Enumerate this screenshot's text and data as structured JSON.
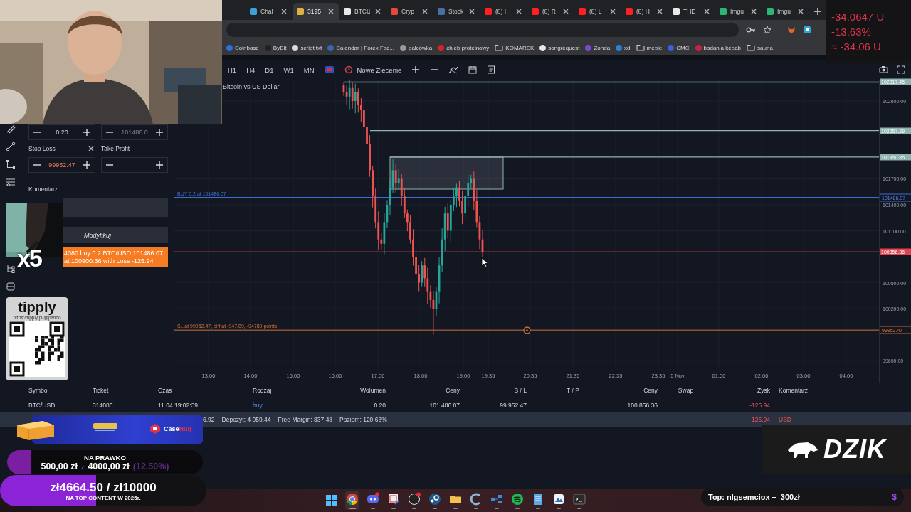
{
  "browser": {
    "tabs": [
      {
        "label": "Chal",
        "color": "#3aa0d8",
        "selected": false
      },
      {
        "label": "3195",
        "color": "#e0b040",
        "selected": true
      },
      {
        "label": "BTCU",
        "color": "#e8e8e8",
        "selected": false
      },
      {
        "label": "Cryp",
        "color": "#e24a3a",
        "selected": false
      },
      {
        "label": "Stock",
        "color": "#4a6fa8",
        "selected": false
      },
      {
        "label": "(8) I",
        "color": "#ff2020",
        "selected": false
      },
      {
        "label": "(8) R",
        "color": "#ff2020",
        "selected": false
      },
      {
        "label": "(8) L",
        "color": "#ff2020",
        "selected": false
      },
      {
        "label": "(8) H",
        "color": "#ff2020",
        "selected": false
      },
      {
        "label": "THE",
        "color": "#e8e8e8",
        "selected": false
      },
      {
        "label": "Imgu",
        "color": "#2bb673",
        "selected": false
      },
      {
        "label": "Imgu",
        "color": "#2bb673",
        "selected": false
      }
    ],
    "bookmarks": [
      {
        "label": "Coinbase",
        "kind": "site",
        "color": "#2f6fe0"
      },
      {
        "label": "ByBit",
        "kind": "site",
        "color": "#222222"
      },
      {
        "label": "script.txt",
        "kind": "site",
        "color": "#dddddd"
      },
      {
        "label": "Calendar | Forex Fac...",
        "kind": "site",
        "color": "#3a66b0"
      },
      {
        "label": "palcówka",
        "kind": "site",
        "color": "#9a9a9a"
      },
      {
        "label": "chleb proteinowy",
        "kind": "site",
        "color": "#e02020"
      },
      {
        "label": "KOMAREK",
        "kind": "folder"
      },
      {
        "label": "songrequest",
        "kind": "site",
        "color": "#e8e8e8"
      },
      {
        "label": "Zonda",
        "kind": "site",
        "color": "#7a4ad0"
      },
      {
        "label": "xd",
        "kind": "site",
        "color": "#2a7fe0"
      },
      {
        "label": "meble",
        "kind": "folder"
      },
      {
        "label": "CMC",
        "kind": "site",
        "color": "#3560e0"
      },
      {
        "label": "badania kebab",
        "kind": "site",
        "color": "#d02040"
      },
      {
        "label": "sauna",
        "kind": "folder"
      }
    ]
  },
  "chart_toolbar": {
    "timeframes": [
      "H1",
      "H4",
      "D1",
      "W1",
      "MN"
    ],
    "new_order": "Nowe Zlecenie"
  },
  "order_panel": {
    "volume": "0.20",
    "price": "101486.0",
    "stop_loss_label": "Stop Loss",
    "stop_loss": "99952.47",
    "take_profit_label": "Take Profit",
    "comment_label": "Komentarz",
    "modify_button": "Modyfikuj",
    "notification": [
      "4080 buy 0.2 BTC/USD 101486.07",
      "at 100900.36 with Loss -125.94"
    ]
  },
  "chart": {
    "title": "Bitcoin vs US Dollar",
    "price_lines": [
      {
        "kind": "level",
        "label": "102817.45"
      },
      {
        "kind": "level",
        "label": "102257.29"
      },
      {
        "kind": "level",
        "label": "101950.85"
      },
      {
        "kind": "buy",
        "label": "101486.07",
        "text": "BUY 0.2 at 101486.07"
      },
      {
        "kind": "current",
        "label": "100856.36"
      },
      {
        "kind": "stop",
        "label": "99952.47",
        "text": "SL at 99952.47, diff at -947.89, -94789 points"
      }
    ],
    "price_ticks": [
      "102600.00",
      "101700.00",
      "101400.00",
      "101100.00",
      "100500.00",
      "100200.00",
      "99600.00"
    ],
    "time_ticks": [
      "13:00",
      "14:00",
      "15:00",
      "16:00",
      "17:00",
      "18:00",
      "19:00",
      "19:35",
      "20:35",
      "21:35",
      "22:35",
      "23:35",
      "5 Nov",
      "01:00",
      "02:00",
      "03:00",
      "04:00"
    ]
  },
  "positions": {
    "columns": [
      "Symbol",
      "Ticket",
      "Czas",
      "Rodzaj",
      "Wolumen",
      "Ceny",
      "S / L",
      "T / P",
      "Ceny",
      "Swap",
      "Zysk",
      "Komentarz"
    ],
    "rows": [
      [
        "BTC/USD",
        "314080",
        "11.04 19:02:39",
        "buy",
        "0.20",
        "101 486.07",
        "99 952.47",
        "",
        "100 856.36",
        "",
        "-125.94",
        ""
      ]
    ],
    "summary": [
      "6.92",
      "Depozyt: 4 059.44",
      "Free Margin: 837.48",
      "Poziom: 120.63%"
    ],
    "summary_profit": "-125.94",
    "summary_currency": "USD"
  },
  "taskbar": {
    "apps": [
      {
        "kind": "windows",
        "selected": false
      },
      {
        "kind": "chrome",
        "selected": true
      },
      {
        "kind": "discord",
        "selected": false
      },
      {
        "kind": "snip",
        "selected": false
      },
      {
        "kind": "obs",
        "selected": false
      },
      {
        "kind": "steam",
        "selected": false
      },
      {
        "kind": "folder",
        "selected": false
      },
      {
        "kind": "cleaner",
        "selected": false
      },
      {
        "kind": "network",
        "selected": false
      },
      {
        "kind": "spotify",
        "selected": false
      },
      {
        "kind": "notepad",
        "selected": false
      },
      {
        "kind": "photos",
        "selected": false
      },
      {
        "kind": "terminal",
        "selected": false
      }
    ]
  },
  "stream_overlays": {
    "webcam": {
      "kind": "picture"
    },
    "stats": [
      "-34.0647 U",
      "-13.63%",
      "≈ -34.06 U"
    ],
    "clip": {
      "kind": "picture",
      "multiplier": "x5"
    },
    "tipply": {
      "brand": "tipply",
      "url": "https://tipply.pl/@patino"
    },
    "casehug": {
      "brand_parts": [
        "Case",
        "Hug"
      ]
    },
    "goal_license": {
      "title": "NA PRAWKO",
      "current": "500,00 zł",
      "separator": "z",
      "target": "4000,00 zł",
      "percent": "(12.50%)",
      "level": 0.125
    },
    "goal_content": {
      "amount": "zł4664.50 / zł10000",
      "subtitle": "NA TOP CONTENT W 2025r.",
      "level": 0.466
    },
    "dzik": {
      "brand": "DZIK"
    },
    "top_donor": {
      "text": "Top: nlgsemciox –  300zł",
      "icon": "$"
    }
  }
}
